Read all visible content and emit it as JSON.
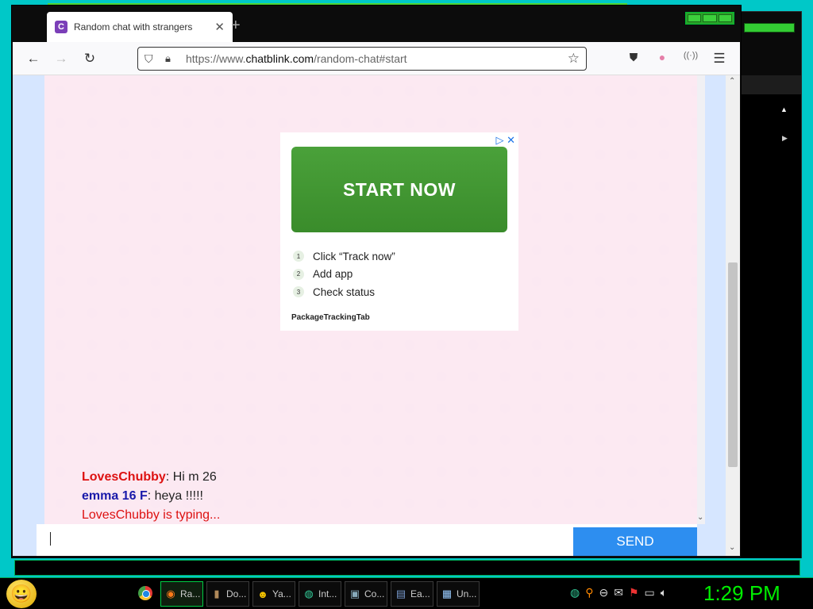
{
  "browser": {
    "tab_title": "Random chat with strangers",
    "tab_favicon": "C",
    "url_domain": "chatblink.com",
    "url_prefix": "https://www.",
    "url_suffix": "/random-chat#start"
  },
  "ad": {
    "cta": "START NOW",
    "steps": [
      {
        "num": "1",
        "text": "Click “Track now”"
      },
      {
        "num": "2",
        "text": "Add app"
      },
      {
        "num": "3",
        "text": "Check status"
      }
    ],
    "brand": "PackageTrackingTab"
  },
  "chat": {
    "messages": [
      {
        "user": "LovesChubby",
        "text": ": Hi m 26"
      },
      {
        "user": "emma 16 F",
        "text": ": heya !!!!!"
      }
    ],
    "typing": "LovesChubby is typing...",
    "send_label": "SEND"
  },
  "taskbar": {
    "tasks": [
      {
        "icon": "firefox-icon",
        "label": "Ra..."
      },
      {
        "icon": "document-icon",
        "label": "Do..."
      },
      {
        "icon": "yahoo-messenger-icon",
        "label": "Ya..."
      },
      {
        "icon": "internet-icon",
        "label": "Int..."
      },
      {
        "icon": "computer-icon",
        "label": "Co..."
      },
      {
        "icon": "ea-icon",
        "label": "Ea..."
      },
      {
        "icon": "notepad-icon",
        "label": "Un..."
      }
    ],
    "clock": "1:29 PM"
  }
}
